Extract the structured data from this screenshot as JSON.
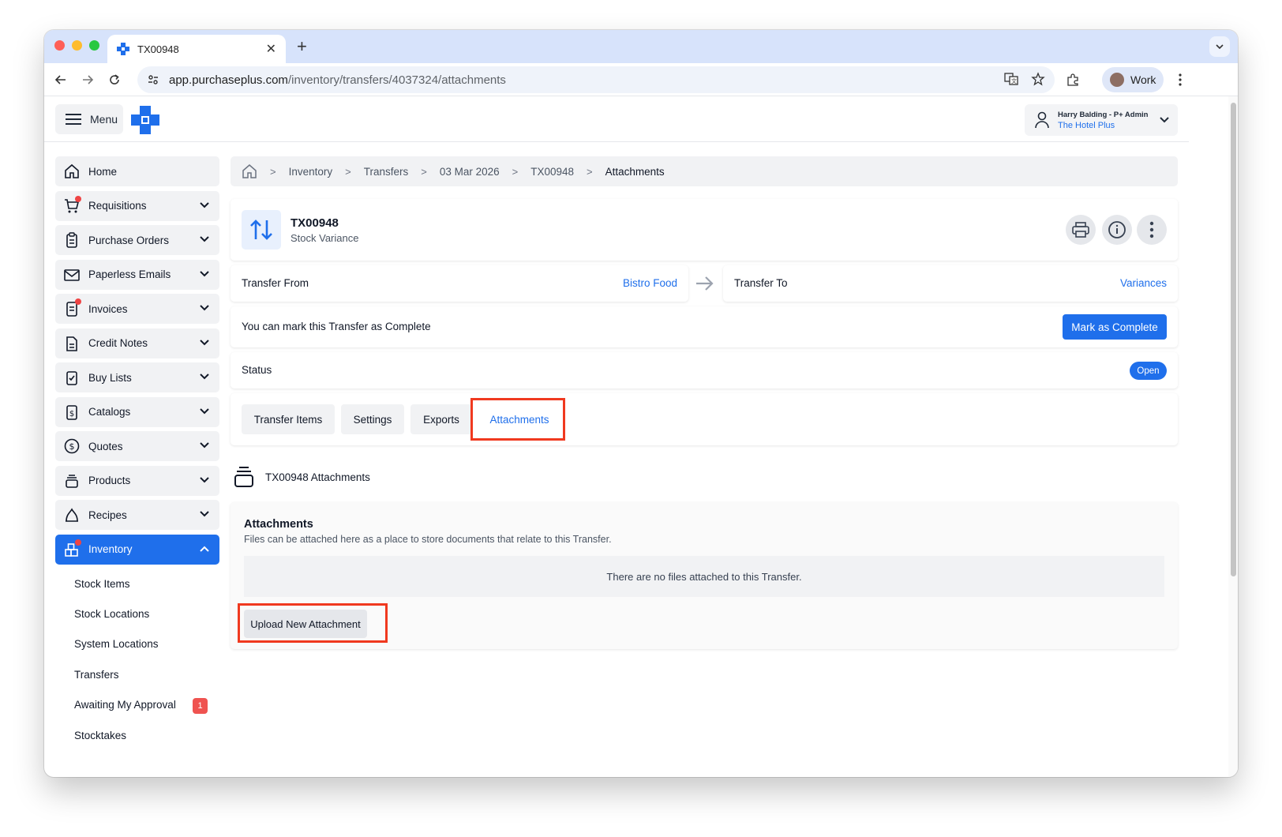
{
  "browser": {
    "tab_title": "TX00948",
    "url_host": "app.purchaseplus.com",
    "url_path": "/inventory/transfers/4037324/attachments",
    "profile_label": "Work"
  },
  "header": {
    "menu_label": "Menu",
    "user_name": "Harry Balding - P+ Admin",
    "user_org": "The Hotel Plus"
  },
  "sidebar": {
    "items": [
      {
        "label": "Home",
        "icon": "home-icon"
      },
      {
        "label": "Requisitions",
        "icon": "cart-icon"
      },
      {
        "label": "Purchase Orders",
        "icon": "clipboard-icon"
      },
      {
        "label": "Paperless Emails",
        "icon": "mail-icon"
      },
      {
        "label": "Invoices",
        "icon": "invoice-icon"
      },
      {
        "label": "Credit Notes",
        "icon": "document-icon"
      },
      {
        "label": "Buy Lists",
        "icon": "checklist-icon"
      },
      {
        "label": "Catalogs",
        "icon": "catalog-icon"
      },
      {
        "label": "Quotes",
        "icon": "dollar-icon"
      },
      {
        "label": "Products",
        "icon": "products-icon"
      },
      {
        "label": "Recipes",
        "icon": "recipes-icon"
      },
      {
        "label": "Inventory",
        "icon": "inventory-icon"
      }
    ],
    "inventory_sub": [
      {
        "label": "Stock Items"
      },
      {
        "label": "Stock Locations"
      },
      {
        "label": "System Locations"
      },
      {
        "label": "Transfers"
      },
      {
        "label": "Awaiting My Approval",
        "badge": "1"
      },
      {
        "label": "Stocktakes"
      }
    ]
  },
  "breadcrumb": {
    "items": [
      "Inventory",
      "Transfers",
      "03 Mar 2026",
      "TX00948",
      "Attachments"
    ]
  },
  "transfer": {
    "id": "TX00948",
    "type": "Stock Variance",
    "from_label": "Transfer From",
    "from_value": "Bistro Food",
    "to_label": "Transfer To",
    "to_value": "Variances",
    "complete_text": "You can mark this Transfer as Complete",
    "complete_button": "Mark as Complete",
    "status_label": "Status",
    "status_value": "Open"
  },
  "tabs": [
    "Transfer Items",
    "Settings",
    "Exports",
    "Attachments"
  ],
  "attachments": {
    "section_title": "TX00948 Attachments",
    "heading": "Attachments",
    "description": "Files can be attached here as a place to store documents that relate to this Transfer.",
    "empty_message": "There are no files attached to this Transfer.",
    "upload_button": "Upload New Attachment"
  },
  "colors": {
    "accent": "#1f6feb",
    "highlight": "#f0391f",
    "badge": "#ef5350"
  }
}
